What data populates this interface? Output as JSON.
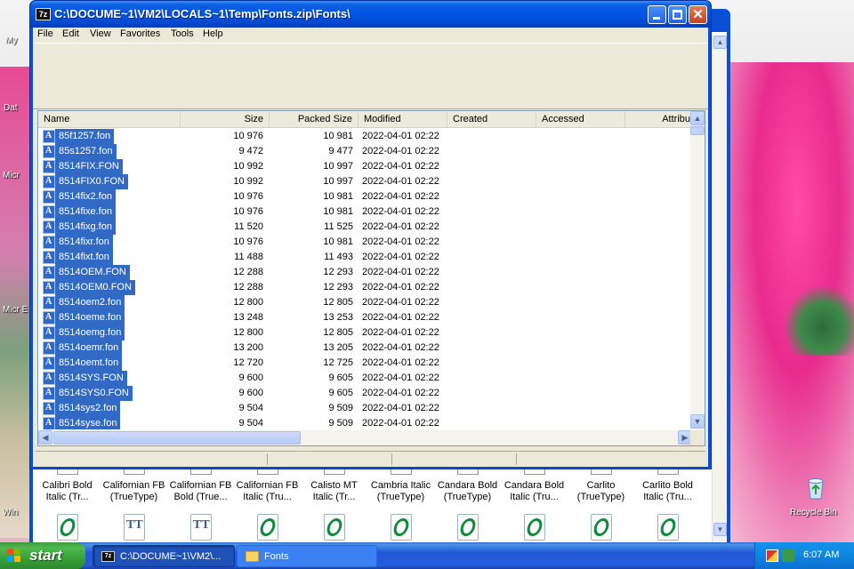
{
  "desktop": {
    "left_labels": [
      "My",
      "Dat",
      "Micr",
      "Micr E",
      "Win"
    ],
    "recycle_bin_label": "Recycle Bin"
  },
  "background_window": {
    "font_items": [
      {
        "line1": "Calibri Bold",
        "line2": "Italic (Tr..."
      },
      {
        "line1": "Californian FB",
        "line2": "(TrueType)"
      },
      {
        "line1": "Californian FB",
        "line2": "Bold (True..."
      },
      {
        "line1": "Californian FB",
        "line2": "Italic (Tru..."
      },
      {
        "line1": "Calisto MT",
        "line2": "Italic (Tr..."
      },
      {
        "line1": "Cambria Italic",
        "line2": "(TrueType)"
      },
      {
        "line1": "Candara Bold",
        "line2": "(TrueType)"
      },
      {
        "line1": "Candara Bold",
        "line2": "Italic (Tru..."
      },
      {
        "line1": "Carlito",
        "line2": "(TrueType)"
      },
      {
        "line1": "Carlito Bold",
        "line2": "Italic (Tru..."
      }
    ],
    "next_row_glyphs": [
      "opentype-font-icon",
      "truetype-font-icon",
      "truetype-font-icon",
      "opentype-font-icon",
      "opentype-font-icon",
      "opentype-font-icon",
      "opentype-font-icon",
      "opentype-font-icon",
      "opentype-font-icon",
      "opentype-font-icon"
    ]
  },
  "window": {
    "title": "C:\\DOCUME~1\\VM2\\LOCALS~1\\Temp\\Fonts.zip\\Fonts\\",
    "app_icon_text": "7z",
    "menu": [
      "File",
      "Edit",
      "View",
      "Favorites",
      "Tools",
      "Help"
    ],
    "columns": {
      "name": "Name",
      "size": "Size",
      "packed": "Packed Size",
      "modified": "Modified",
      "created": "Created",
      "accessed": "Accessed",
      "attributes": "Attribu"
    },
    "files": [
      {
        "name": "85f1257.fon",
        "size": "10 976",
        "packed": "10 981",
        "modified": "2022-04-01 02:22"
      },
      {
        "name": "85s1257.fon",
        "size": "9 472",
        "packed": "9 477",
        "modified": "2022-04-01 02:22"
      },
      {
        "name": "8514FIX.FON",
        "size": "10 992",
        "packed": "10 997",
        "modified": "2022-04-01 02:22"
      },
      {
        "name": "8514FIX0.FON",
        "size": "10 992",
        "packed": "10 997",
        "modified": "2022-04-01 02:22"
      },
      {
        "name": "8514fix2.fon",
        "size": "10 976",
        "packed": "10 981",
        "modified": "2022-04-01 02:22"
      },
      {
        "name": "8514fixe.fon",
        "size": "10 976",
        "packed": "10 981",
        "modified": "2022-04-01 02:22"
      },
      {
        "name": "8514fixg.fon",
        "size": "11 520",
        "packed": "11 525",
        "modified": "2022-04-01 02:22"
      },
      {
        "name": "8514fixr.fon",
        "size": "10 976",
        "packed": "10 981",
        "modified": "2022-04-01 02:22"
      },
      {
        "name": "8514fixt.fon",
        "size": "11 488",
        "packed": "11 493",
        "modified": "2022-04-01 02:22"
      },
      {
        "name": "8514OEM.FON",
        "size": "12 288",
        "packed": "12 293",
        "modified": "2022-04-01 02:22"
      },
      {
        "name": "8514OEM0.FON",
        "size": "12 288",
        "packed": "12 293",
        "modified": "2022-04-01 02:22"
      },
      {
        "name": "8514oem2.fon",
        "size": "12 800",
        "packed": "12 805",
        "modified": "2022-04-01 02:22"
      },
      {
        "name": "8514oeme.fon",
        "size": "13 248",
        "packed": "13 253",
        "modified": "2022-04-01 02:22"
      },
      {
        "name": "8514oemg.fon",
        "size": "12 800",
        "packed": "12 805",
        "modified": "2022-04-01 02:22"
      },
      {
        "name": "8514oemr.fon",
        "size": "13 200",
        "packed": "13 205",
        "modified": "2022-04-01 02:22"
      },
      {
        "name": "8514oemt.fon",
        "size": "12 720",
        "packed": "12 725",
        "modified": "2022-04-01 02:22"
      },
      {
        "name": "8514SYS.FON",
        "size": "9 600",
        "packed": "9 605",
        "modified": "2022-04-01 02:22"
      },
      {
        "name": "8514SYS0.FON",
        "size": "9 600",
        "packed": "9 605",
        "modified": "2022-04-01 02:22"
      },
      {
        "name": "8514sys2.fon",
        "size": "9 504",
        "packed": "9 509",
        "modified": "2022-04-01 02:22"
      },
      {
        "name": "8514syse.fon",
        "size": "9 504",
        "packed": "9 509",
        "modified": "2022-04-01 02:22"
      }
    ]
  },
  "taskbar": {
    "start_label": "start",
    "tasks": [
      {
        "label": "C:\\DOCUME~1\\VM2\\...",
        "active": true
      },
      {
        "label": "Fonts",
        "active": false
      }
    ],
    "clock": "6:07 AM"
  },
  "colors": {
    "selection": "#316ac5",
    "title_bar": "#0055e5",
    "taskbar": "#245edb",
    "start_button": "#3c9a3c"
  }
}
